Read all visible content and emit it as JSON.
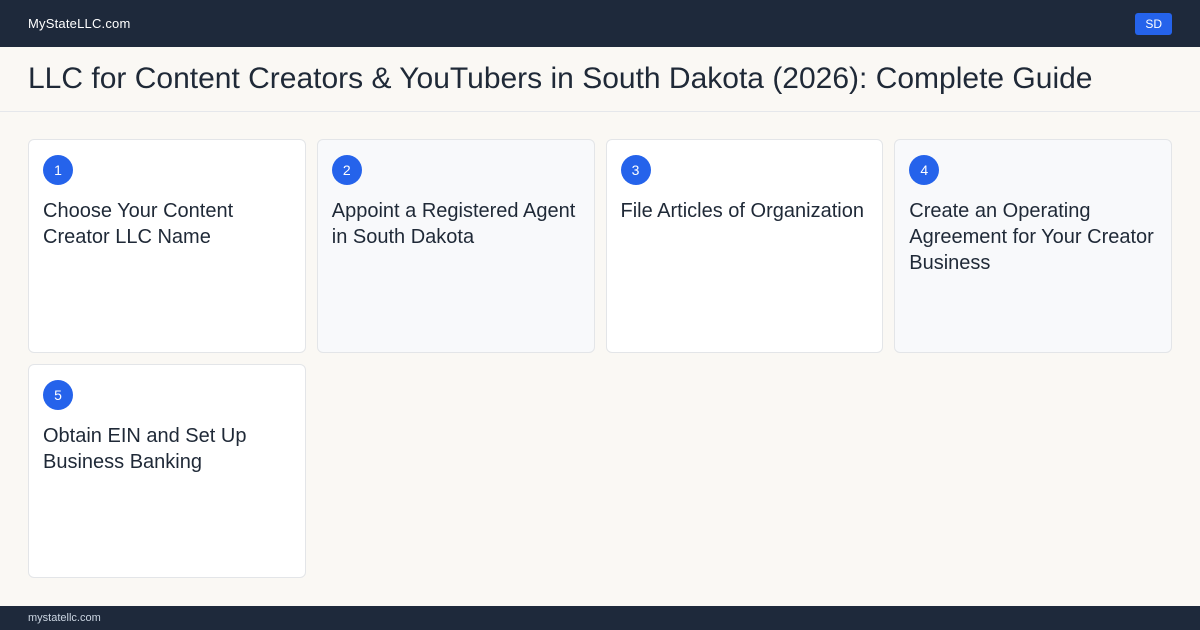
{
  "header": {
    "brand": "MyStateLLC.com",
    "state_badge": "SD"
  },
  "page": {
    "title": "LLC for Content Creators & YouTubers  in South Dakota (2026): Complete Guide"
  },
  "steps": [
    {
      "number": "1",
      "title": "Choose Your Content Creator LLC Name"
    },
    {
      "number": "2",
      "title": "Appoint a Registered Agent in South Dakota"
    },
    {
      "number": "3",
      "title": "File Articles of Organization"
    },
    {
      "number": "4",
      "title": "Create an Operating Agreement for Your Creator Business"
    },
    {
      "number": "5",
      "title": "Obtain EIN and Set Up Business Banking"
    }
  ],
  "footer": {
    "domain": "mystatellc.com"
  },
  "colors": {
    "nav_bg": "#1e293b",
    "accent": "#2563eb",
    "page_bg": "#faf8f4"
  }
}
